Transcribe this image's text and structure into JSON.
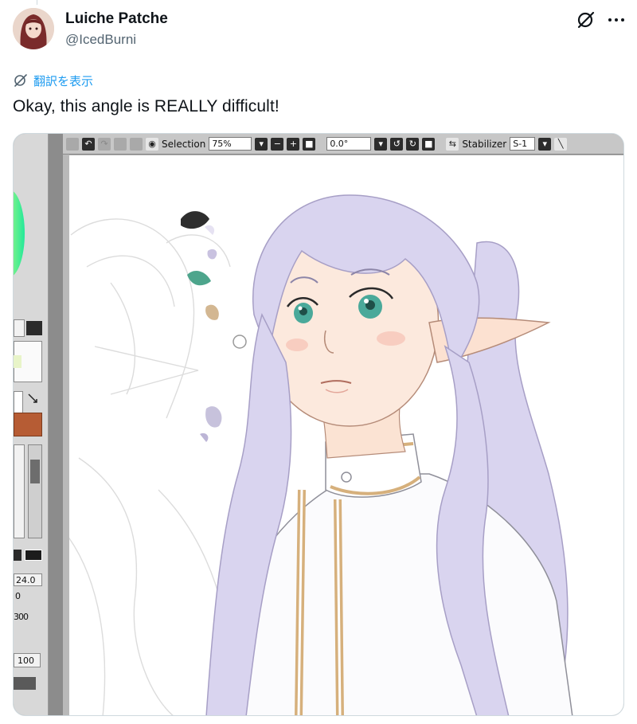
{
  "tweet": {
    "author_name": "Luiche Patche",
    "author_handle": "@IcedBurni",
    "translate_label": "翻訳を表示",
    "text": "Okay, this angle is REALLY difficult!"
  },
  "icons": {
    "grok": "grok-icon",
    "more": "more-icon",
    "translate": "translate-icon"
  },
  "colors": {
    "link": "#1d9bf0",
    "hair": "#d9d4ef",
    "eyes": "#4aa99a",
    "coat_trim": "#d6b07c"
  },
  "app": {
    "toolbar": {
      "selection_label": "Selection",
      "zoom_value": "75%",
      "rotation_value": "0.0°",
      "stabilizer_label": "Stabilizer",
      "stabilizer_value": "S-1"
    },
    "left_panel": {
      "brush_size": "24.0",
      "density": "100",
      "brush_value_short": "0",
      "pattern_label": "300"
    }
  }
}
